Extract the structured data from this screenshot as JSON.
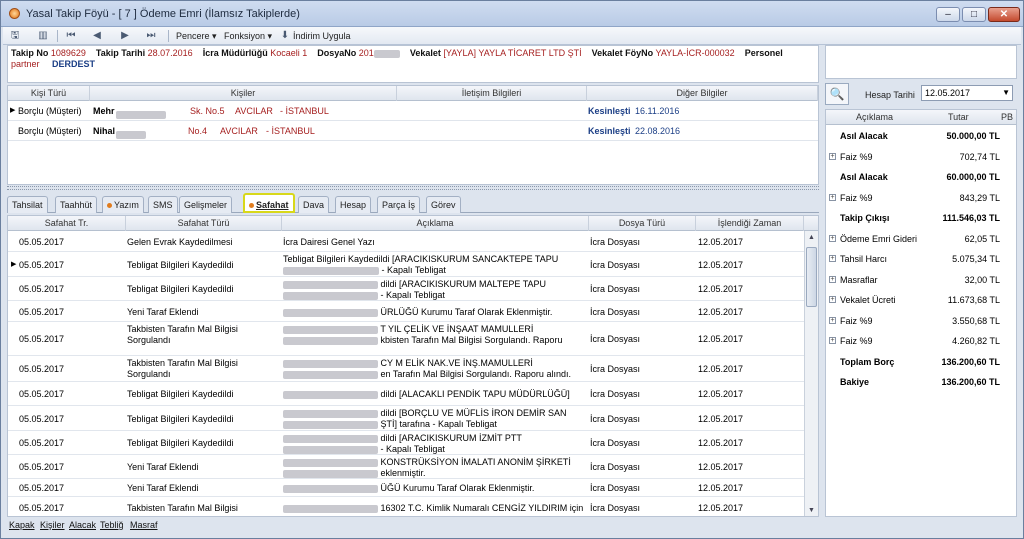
{
  "window": {
    "title": "Yasal Takip Föyü - [ 7 ] Ödeme Emri (İlamsız Takiplerde)",
    "min": "–",
    "max": "□",
    "close": "✕"
  },
  "toolbar": {
    "pencere": "Pencere ▾",
    "fonksiyon": "Fonksiyon ▾",
    "indirim": "İndirim Uygula"
  },
  "info": {
    "takip_no_lbl": "Takip No",
    "takip_no": "1089629",
    "takip_tarihi_lbl": "Takip Tarihi",
    "takip_tarihi": "28.07.2016",
    "icra_lbl": "İcra Müdürlüğü",
    "icra": "Kocaeli 1",
    "dosya_lbl": "DosyaNo",
    "dosya": "201",
    "vekalet_lbl": "Vekalet",
    "vekalet": "[YAYLA] YAYLA TİCARET LTD ŞTİ",
    "vekalet_foy_lbl": "Vekalet FöyNo",
    "vekalet_foy": "YAYLA-İCR-000032",
    "personel_lbl": "Personel",
    "partner": "partner",
    "durum": "DERDEST"
  },
  "parties": {
    "headers": [
      "Kişi Türü",
      "Kişiler",
      "İletişim Bilgileri",
      "Diğer Bilgiler"
    ],
    "rows": [
      {
        "tur": "Borçlu (Müşteri)",
        "ad": "Mehr",
        "adres": "Sk. No.5",
        "ilce": "AVCILAR",
        "il": "- İSTANBUL",
        "durum": "Kesinleşti",
        "tarih": "16.11.2016"
      },
      {
        "tur": "Borçlu (Müşteri)",
        "ad": "Nihal",
        "adres": "No.4",
        "ilce": "AVCILAR",
        "il": "- İSTANBUL",
        "durum": "Kesinleşti",
        "tarih": "22.08.2016"
      }
    ]
  },
  "tabs": [
    "Tahsilat",
    "Taahhüt",
    "Yazım",
    "SMS",
    "Gelişmeler",
    "Safahat",
    "Dava",
    "Hesap",
    "Parça İş",
    "Görev"
  ],
  "events": {
    "headers": [
      "Safahat Tr.",
      "Safahat Türü",
      "Açıklama",
      "Dosya Türü",
      "İşlendiği Zaman"
    ],
    "rows": [
      {
        "tarih": "05.05.2017",
        "tur": "Gelen Evrak Kaydedilmesi",
        "tur2": "",
        "acik1": "İcra Dairesi Genel Yazı",
        "acik2": "",
        "dosya": "İcra Dosyası",
        "zaman": "12.05.2017"
      },
      {
        "tarih": "05.05.2017",
        "tur": "Tebligat Bilgileri Kaydedildi",
        "tur2": "",
        "acik1": "Tebligat Bilgileri Kaydedildi [ARACIKISKURUM SANCAKTEPE TAPU",
        "acik2": "- Kapalı Tebligat",
        "dosya": "İcra Dosyası",
        "zaman": "12.05.2017"
      },
      {
        "tarih": "05.05.2017",
        "tur": "Tebligat Bilgileri Kaydedildi",
        "tur2": "",
        "acik1": "dildi [ARACIKISKURUM MALTEPE TAPU",
        "acik2": "- Kapalı Tebligat",
        "dosya": "İcra Dosyası",
        "zaman": "12.05.2017"
      },
      {
        "tarih": "05.05.2017",
        "tur": "Yeni Taraf Eklendi",
        "tur2": "",
        "acik1": "ÜRLÜĞÜ Kurumu Taraf Olarak Eklenmiştir.",
        "acik2": "",
        "dosya": "İcra Dosyası",
        "zaman": "12.05.2017"
      },
      {
        "tarih": "05.05.2017",
        "tur": "Takbisten Tarafın Mal Bilgisi",
        "tur2": "Sorgulandı",
        "acik1": "T YIL ÇELİK VE İNŞAAT MAMULLERİ",
        "acik2": "kbisten Tarafın Mal Bilgisi Sorgulandı. Raporu",
        "dosya": "İcra Dosyası",
        "zaman": "12.05.2017"
      },
      {
        "tarih": "05.05.2017",
        "tur": "Takbisten Tarafın Mal Bilgisi",
        "tur2": "Sorgulandı",
        "acik1": "CY M ELİK NAK.VE İNŞ.MAMULLERİ",
        "acik2": "en Tarafın Mal Bilgisi Sorgulandı. Raporu alındı.",
        "dosya": "İcra Dosyası",
        "zaman": "12.05.2017"
      },
      {
        "tarih": "05.05.2017",
        "tur": "Tebligat Bilgileri Kaydedildi",
        "tur2": "",
        "acik1": "dildi [ALACAKLI PENDİK TAPU MÜDÜRLÜĞÜ]",
        "acik2": "",
        "dosya": "İcra Dosyası",
        "zaman": "12.05.2017"
      },
      {
        "tarih": "05.05.2017",
        "tur": "Tebligat Bilgileri Kaydedildi",
        "tur2": "",
        "acik1": "dildi [BORÇLU VE MÜFLİS İRON DEMİR SAN",
        "acik2": "ŞTİ] tarafına - Kapalı Tebligat",
        "dosya": "İcra Dosyası",
        "zaman": "12.05.2017"
      },
      {
        "tarih": "05.05.2017",
        "tur": "Tebligat Bilgileri Kaydedildi",
        "tur2": "",
        "acik1": "dildi [ARACIKISKURUM İZMİT PTT",
        "acik2": "- Kapalı Tebligat",
        "dosya": "İcra Dosyası",
        "zaman": "12.05.2017"
      },
      {
        "tarih": "05.05.2017",
        "tur": "Yeni Taraf Eklendi",
        "tur2": "",
        "acik1": "KONSTRÜKSİYON İMALATI ANONİM ŞİRKETİ",
        "acik2": "eklenmiştir.",
        "dosya": "İcra Dosyası",
        "zaman": "12.05.2017"
      },
      {
        "tarih": "05.05.2017",
        "tur": "Yeni Taraf Eklendi",
        "tur2": "",
        "acik1": "ÜĞÜ Kurumu Taraf Olarak Eklenmiştir.",
        "acik2": "",
        "dosya": "İcra Dosyası",
        "zaman": "12.05.2017"
      },
      {
        "tarih": "05.05.2017",
        "tur": "Takbisten Tarafın Mal Bilgisi",
        "tur2": "",
        "acik1": "16302 T.C. Kimlik Numaralı CENGİZ YILDIRIM için",
        "acik2": "",
        "dosya": "İcra Dosyası",
        "zaman": "12.05.2017"
      }
    ]
  },
  "hesap": {
    "label": "Hesap Tarihi",
    "date": "12.05.2017",
    "headers": [
      "Açıklama",
      "Tutar",
      "PB"
    ],
    "rows": [
      {
        "lbl": "Asıl Alacak",
        "val": "50.000,00 TL",
        "plus": false,
        "bold": true
      },
      {
        "lbl": "Faiz %9",
        "val": "702,74 TL",
        "plus": true,
        "bold": false
      },
      {
        "lbl": "Asıl Alacak",
        "val": "60.000,00 TL",
        "plus": false,
        "bold": true
      },
      {
        "lbl": "Faiz %9",
        "val": "843,29 TL",
        "plus": true,
        "bold": false
      },
      {
        "lbl": "Takip Çıkışı",
        "val": "111.546,03 TL",
        "plus": false,
        "bold": true
      },
      {
        "lbl": "Ödeme Emri Gideri",
        "val": "62,05 TL",
        "plus": true,
        "bold": false
      },
      {
        "lbl": "Tahsil Harcı",
        "val": "5.075,34 TL",
        "plus": true,
        "bold": false
      },
      {
        "lbl": "Masraflar",
        "val": "32,00 TL",
        "plus": true,
        "bold": false
      },
      {
        "lbl": "Vekalet Ücreti",
        "val": "11.673,68 TL",
        "plus": true,
        "bold": false
      },
      {
        "lbl": "Faiz %9",
        "val": "3.550,68 TL",
        "plus": true,
        "bold": false
      },
      {
        "lbl": "Faiz %9",
        "val": "4.260,82 TL",
        "plus": true,
        "bold": false
      },
      {
        "lbl": "Toplam Borç",
        "val": "136.200,60 TL",
        "plus": false,
        "bold": true
      },
      {
        "lbl": "Bakiye",
        "val": "136.200,60 TL",
        "plus": false,
        "bold": true
      }
    ]
  },
  "bottom": [
    "Kapak",
    "Kişiler",
    "Alacak",
    "Tebliğ",
    "Masraf"
  ]
}
